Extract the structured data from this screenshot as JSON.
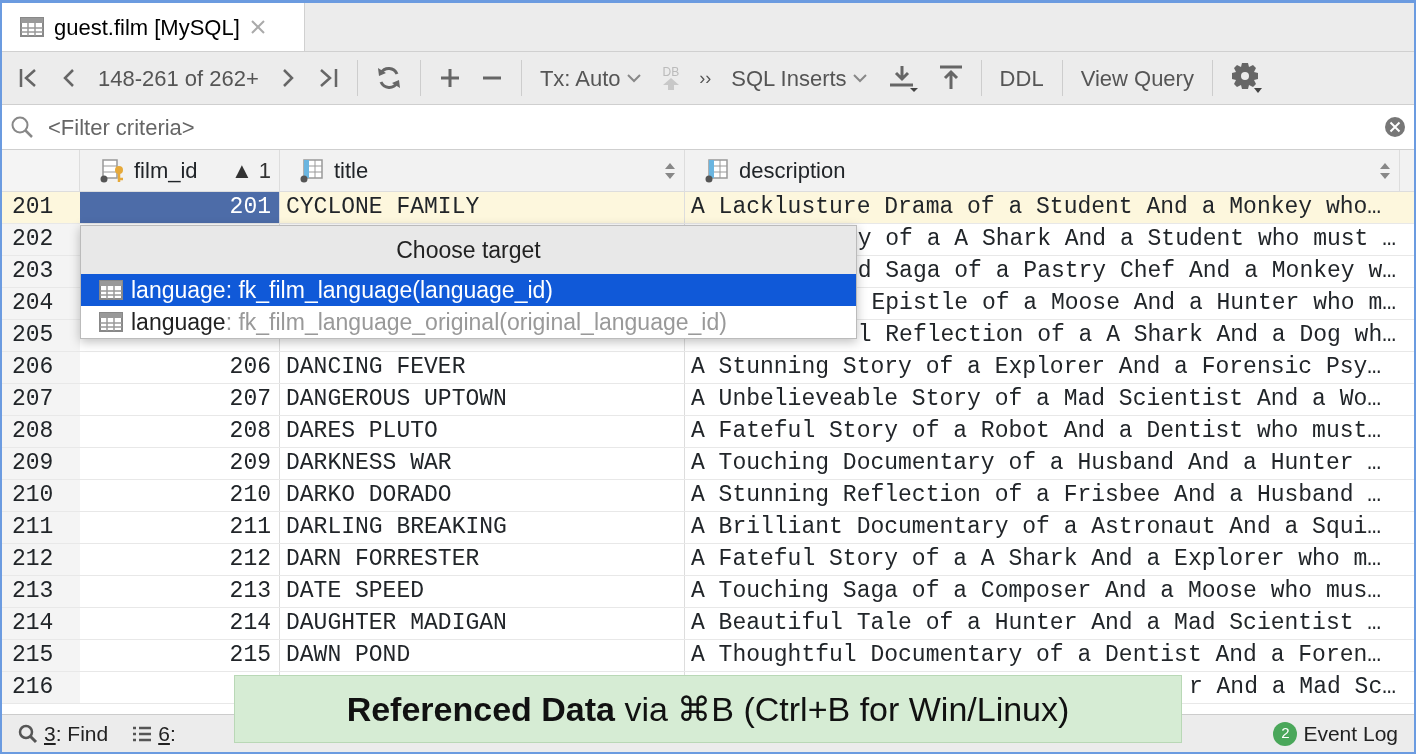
{
  "tab": {
    "title": "guest.film [MySQL]",
    "selected": true
  },
  "toolbar": {
    "range": "148-261 of 262+",
    "tx": "Tx: Auto",
    "db": "DB",
    "more": "››",
    "export_format": "SQL Inserts",
    "ddl": "DDL",
    "view_query": "View Query"
  },
  "filter": {
    "placeholder": "<Filter criteria>"
  },
  "table": {
    "columns": [
      {
        "kind": "key",
        "label": "film_id",
        "sort": "▲ 1"
      },
      {
        "kind": "text",
        "label": "title"
      },
      {
        "kind": "text",
        "label": "description"
      }
    ],
    "rows": [
      {
        "kind": "full",
        "row": "201",
        "film_id": "201",
        "title": "CYCLONE FAMILY",
        "description": "A Lacklusture Drama of a Student And a Monkey who…",
        "selected": true
      },
      {
        "kind": "covered",
        "row": "202",
        "description": "y of a A Shark And a Student who must …",
        "selected": false
      },
      {
        "kind": "covered",
        "row": "203",
        "description": "d Saga of a Pastry Chef And a Monkey w…",
        "selected": false
      },
      {
        "kind": "covered",
        "row": "204",
        "description": "Epistle of a Moose And a Hunter who m…",
        "selected": false
      },
      {
        "kind": "covered",
        "row": "205",
        "description": "l Reflection of a A Shark And a Dog wh…",
        "selected": false
      },
      {
        "kind": "full",
        "row": "206",
        "film_id": "206",
        "title": "DANCING FEVER",
        "description": "A Stunning Story of a Explorer And a Forensic Psy…",
        "selected": false
      },
      {
        "kind": "full",
        "row": "207",
        "film_id": "207",
        "title": "DANGEROUS UPTOWN",
        "description": "A Unbelieveable Story of a Mad Scientist And a Wo…",
        "selected": false
      },
      {
        "kind": "full",
        "row": "208",
        "film_id": "208",
        "title": "DARES PLUTO",
        "description": "A Fateful Story of a Robot And a Dentist who must…",
        "selected": false
      },
      {
        "kind": "full",
        "row": "209",
        "film_id": "209",
        "title": "DARKNESS WAR",
        "description": "A Touching Documentary of a Husband And a Hunter …",
        "selected": false
      },
      {
        "kind": "full",
        "row": "210",
        "film_id": "210",
        "title": "DARKO DORADO",
        "description": "A Stunning Reflection of a Frisbee And a Husband …",
        "selected": false
      },
      {
        "kind": "full",
        "row": "211",
        "film_id": "211",
        "title": "DARLING BREAKING",
        "description": "A Brilliant Documentary of a Astronaut And a Squi…",
        "selected": false
      },
      {
        "kind": "full",
        "row": "212",
        "film_id": "212",
        "title": "DARN FORRESTER",
        "description": "A Fateful Story of a A Shark And a Explorer who m…",
        "selected": false
      },
      {
        "kind": "full",
        "row": "213",
        "film_id": "213",
        "title": "DATE SPEED",
        "description": "A Touching Saga of a Composer And a Moose who mus…",
        "selected": false
      },
      {
        "kind": "full",
        "row": "214",
        "film_id": "214",
        "title": "DAUGHTER MADIGAN",
        "description": "A Beautiful Tale of a Hunter And a Mad Scientist …",
        "selected": false
      },
      {
        "kind": "full",
        "row": "215",
        "film_id": "215",
        "title": "DAWN POND",
        "description": "A Thoughtful Documentary of a Dentist And a Foren…",
        "selected": false
      },
      {
        "kind": "covered",
        "row": "216",
        "description": "r And a Mad Sc…",
        "selected": false
      }
    ]
  },
  "popup": {
    "title": "Choose target",
    "items": [
      {
        "name": "language",
        "detail": ": fk_film_language(language_id)",
        "selected": true
      },
      {
        "name": "language",
        "detail": ": fk_film_language_original(original_language_id)",
        "selected": false
      }
    ]
  },
  "banner": "**Referenced Data** via ⌘B (Ctrl+B for Win/Linux)",
  "status_bar": {
    "items": [
      {
        "kind": "find",
        "key": "3",
        "label": ": Find"
      },
      {
        "kind": "todo",
        "key": "6",
        "label": ":"
      }
    ],
    "event_log": {
      "count": "2",
      "label": "Event Log"
    }
  }
}
